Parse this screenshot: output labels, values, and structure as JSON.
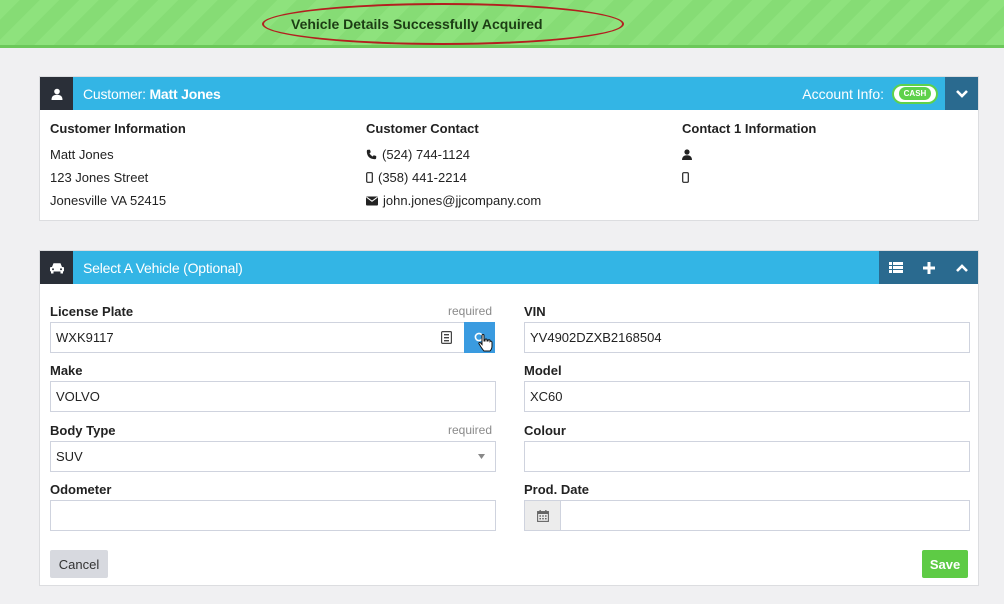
{
  "banner": {
    "message": "Vehicle Details Successfully Acquired"
  },
  "customer_panel": {
    "title_prefix": "Customer: ",
    "customer_name": "Matt Jones",
    "account_info_label": "Account Info:",
    "account_badge": "CASH",
    "info": {
      "heading": "Customer Information",
      "name": "Matt Jones",
      "street": "123 Jones Street",
      "city": "Jonesville VA 52415"
    },
    "contact": {
      "heading": "Customer Contact",
      "phone": "(524) 744-1124",
      "mobile": "(358) 441-2214",
      "email": "john.jones@jjcompany.com"
    },
    "contact1": {
      "heading": "Contact 1 Information"
    }
  },
  "vehicle_panel": {
    "title": "Select A Vehicle (Optional)",
    "fields": {
      "license_plate": {
        "label": "License Plate",
        "required": "required",
        "value": "WXK9117"
      },
      "vin": {
        "label": "VIN",
        "value": "YV4902DZXB2168504"
      },
      "make": {
        "label": "Make",
        "value": "VOLVO"
      },
      "model": {
        "label": "Model",
        "value": "XC60"
      },
      "body_type": {
        "label": "Body Type",
        "required": "required",
        "value": "SUV"
      },
      "colour": {
        "label": "Colour",
        "value": ""
      },
      "odometer": {
        "label": "Odometer",
        "value": ""
      },
      "prod_date": {
        "label": "Prod. Date",
        "value": ""
      }
    },
    "buttons": {
      "cancel": "Cancel",
      "save": "Save"
    }
  },
  "colors": {
    "header_blue": "#33b5e5",
    "dark": "#2a2f38",
    "success_green": "#5ecb45",
    "highlight_ellipse": "#b31f1f"
  },
  "icons": [
    "user-icon",
    "chevron-down-icon",
    "phone-icon",
    "mobile-icon",
    "envelope-icon",
    "car-icon",
    "list-icon",
    "plus-icon",
    "chevron-up-icon",
    "id-card-icon",
    "search-icon",
    "hand-cursor-icon",
    "caret-down-icon",
    "calendar-icon"
  ]
}
